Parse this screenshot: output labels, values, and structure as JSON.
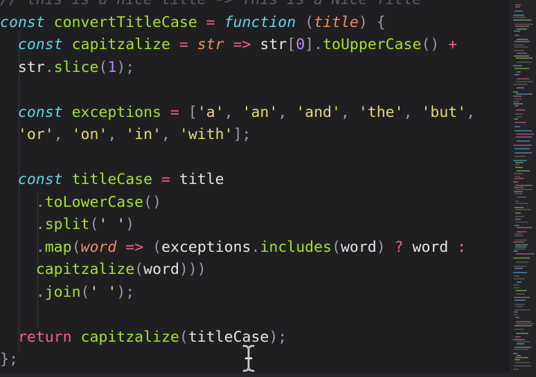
{
  "colors": {
    "background": "#1f1f22",
    "comment": "#5a5a60",
    "keyword": "#5fd7e4",
    "function_name": "#a6e22e",
    "plain": "#e6e6e6",
    "param": "#f48c5c",
    "operator": "#ff5c8a",
    "string": "#e6db74",
    "number": "#b98cf2",
    "property": "#7fc6ff",
    "variable": "#b9a6f8",
    "punct": "#9a9aa2"
  },
  "code_lines": [
    [
      {
        "t": "// this is a nice title -> This Is a Nice Title",
        "c": "comment",
        "i": true
      }
    ],
    [
      {
        "t": "const ",
        "c": "keyword",
        "i": true
      },
      {
        "t": "convertTitleCase",
        "c": "function_name"
      },
      {
        "t": " = ",
        "c": "operator"
      },
      {
        "t": "function",
        "c": "keyword",
        "i": true
      },
      {
        "t": " (",
        "c": "punct"
      },
      {
        "t": "title",
        "c": "param",
        "i": true
      },
      {
        "t": ") {",
        "c": "punct"
      }
    ],
    [
      {
        "t": "  const ",
        "c": "keyword",
        "i": true
      },
      {
        "t": "capitzalize",
        "c": "function_name"
      },
      {
        "t": " = ",
        "c": "operator"
      },
      {
        "t": "str",
        "c": "param",
        "i": true
      },
      {
        "t": " => ",
        "c": "operator"
      },
      {
        "t": "str",
        "c": "plain"
      },
      {
        "t": "[",
        "c": "punct"
      },
      {
        "t": "0",
        "c": "number"
      },
      {
        "t": "].",
        "c": "punct"
      },
      {
        "t": "toUpperCase",
        "c": "function_name"
      },
      {
        "t": "() ",
        "c": "punct"
      },
      {
        "t": "+",
        "c": "operator"
      }
    ],
    [
      {
        "t": "  str",
        "c": "plain"
      },
      {
        "t": ".",
        "c": "punct"
      },
      {
        "t": "slice",
        "c": "function_name"
      },
      {
        "t": "(",
        "c": "punct"
      },
      {
        "t": "1",
        "c": "number"
      },
      {
        "t": ");",
        "c": "punct"
      }
    ],
    [],
    [
      {
        "t": "  const ",
        "c": "keyword",
        "i": true
      },
      {
        "t": "exceptions",
        "c": "function_name"
      },
      {
        "t": " = ",
        "c": "operator"
      },
      {
        "t": "[",
        "c": "punct"
      },
      {
        "t": "'a'",
        "c": "string"
      },
      {
        "t": ", ",
        "c": "punct"
      },
      {
        "t": "'an'",
        "c": "string"
      },
      {
        "t": ", ",
        "c": "punct"
      },
      {
        "t": "'and'",
        "c": "string"
      },
      {
        "t": ", ",
        "c": "punct"
      },
      {
        "t": "'the'",
        "c": "string"
      },
      {
        "t": ", ",
        "c": "punct"
      },
      {
        "t": "'but'",
        "c": "string"
      },
      {
        "t": ",",
        "c": "punct"
      }
    ],
    [
      {
        "t": "  'or'",
        "c": "string"
      },
      {
        "t": ", ",
        "c": "punct"
      },
      {
        "t": "'on'",
        "c": "string"
      },
      {
        "t": ", ",
        "c": "punct"
      },
      {
        "t": "'in'",
        "c": "string"
      },
      {
        "t": ", ",
        "c": "punct"
      },
      {
        "t": "'with'",
        "c": "string"
      },
      {
        "t": "];",
        "c": "punct"
      }
    ],
    [],
    [
      {
        "t": "  const ",
        "c": "keyword",
        "i": true
      },
      {
        "t": "titleCase",
        "c": "function_name"
      },
      {
        "t": " = ",
        "c": "operator"
      },
      {
        "t": "title",
        "c": "plain"
      }
    ],
    [
      {
        "t": "    .",
        "c": "punct"
      },
      {
        "t": "toLowerCase",
        "c": "function_name"
      },
      {
        "t": "()",
        "c": "punct"
      }
    ],
    [
      {
        "t": "    .",
        "c": "punct"
      },
      {
        "t": "split",
        "c": "function_name"
      },
      {
        "t": "(",
        "c": "punct"
      },
      {
        "t": "' '",
        "c": "string"
      },
      {
        "t": ")",
        "c": "punct"
      }
    ],
    [
      {
        "t": "    .",
        "c": "punct"
      },
      {
        "t": "map",
        "c": "function_name"
      },
      {
        "t": "(",
        "c": "punct"
      },
      {
        "t": "word",
        "c": "param",
        "i": true
      },
      {
        "t": " => ",
        "c": "operator"
      },
      {
        "t": "(",
        "c": "punct"
      },
      {
        "t": "exceptions",
        "c": "plain"
      },
      {
        "t": ".",
        "c": "punct"
      },
      {
        "t": "includes",
        "c": "function_name"
      },
      {
        "t": "(",
        "c": "punct"
      },
      {
        "t": "word",
        "c": "plain"
      },
      {
        "t": ") ",
        "c": "punct"
      },
      {
        "t": "?",
        "c": "operator"
      },
      {
        "t": " word ",
        "c": "plain"
      },
      {
        "t": ":",
        "c": "operator"
      }
    ],
    [
      {
        "t": "    capitzalize",
        "c": "function_name"
      },
      {
        "t": "(",
        "c": "punct"
      },
      {
        "t": "word",
        "c": "plain"
      },
      {
        "t": ")))",
        "c": "punct"
      }
    ],
    [
      {
        "t": "    .",
        "c": "punct"
      },
      {
        "t": "join",
        "c": "function_name"
      },
      {
        "t": "(",
        "c": "punct"
      },
      {
        "t": "' '",
        "c": "string"
      },
      {
        "t": ");",
        "c": "punct"
      }
    ],
    [],
    [
      {
        "t": "  return ",
        "c": "operator"
      },
      {
        "t": "capitzalize",
        "c": "function_name"
      },
      {
        "t": "(",
        "c": "punct"
      },
      {
        "t": "titleCase",
        "c": "plain"
      },
      {
        "t": ");",
        "c": "punct"
      }
    ],
    [
      {
        "t": "};",
        "c": "punct"
      }
    ]
  ],
  "icons": {
    "text_cursor": "i-beam-cursor-icon"
  }
}
